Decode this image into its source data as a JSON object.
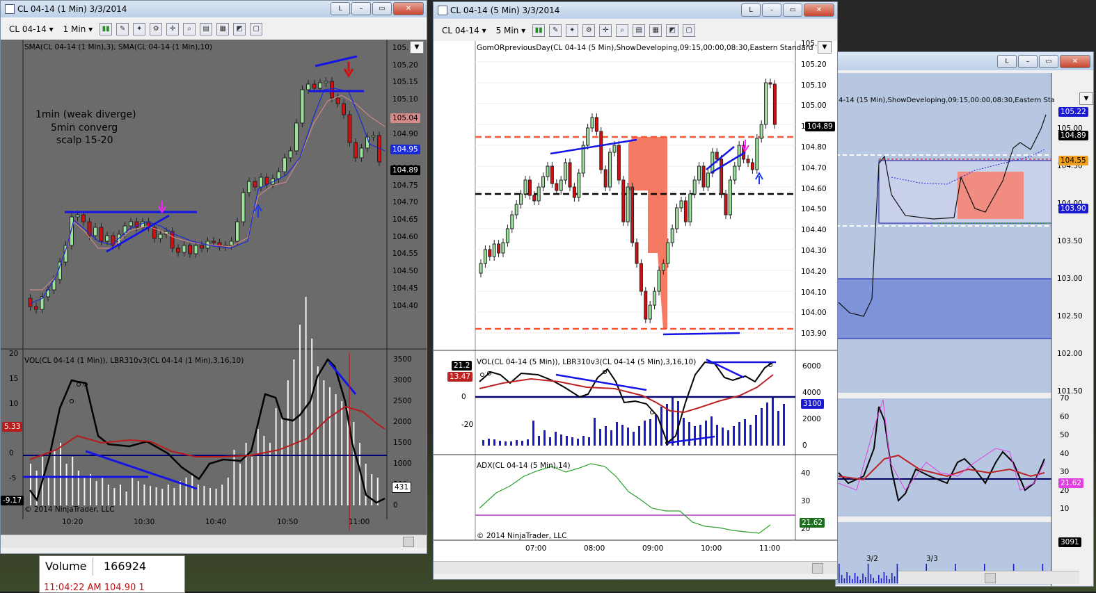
{
  "windows": {
    "left": {
      "title": "CL 04-14 (1 Min)  3/3/2014",
      "instrument": "CL 04-14",
      "interval": "1 Min",
      "btn_l": "L",
      "price_indicator": "SMA(CL 04-14 (1 Min),3), SMA(CL 04-14 (1 Min),10)",
      "note_lines": [
        "1min (weak diverge)",
        "5min converg",
        "scalp 15-20"
      ],
      "price_ticks": [
        "105.",
        "105.20",
        "105.15",
        "105.10",
        "105.00",
        "104.90",
        "104.85",
        "104.80",
        "104.75",
        "104.70",
        "104.65",
        "104.60",
        "104.55",
        "104.50",
        "104.45",
        "104.40"
      ],
      "price_tags": {
        "sma_red": "105.04",
        "sma_blue": "104.95",
        "last": "104.89"
      },
      "osc_indicator": "VOL(CL 04-14 (1 Min)), LBR310v3(CL 04-14 (1 Min),3,16,10)",
      "osc_left_ticks": [
        "20",
        "15",
        "10",
        "5",
        "0",
        "-5",
        "-10"
      ],
      "osc_tags": {
        "osc_red": "5.33",
        "osc_black": "-9.17",
        "vol": "431"
      },
      "vol_ticks": [
        "3500",
        "3000",
        "2500",
        "2000",
        "1500",
        "1000",
        "500",
        "0"
      ],
      "copyright": "© 2014 NinjaTrader, LLC",
      "time_ticks": [
        "10:20",
        "10:30",
        "10:40",
        "10:50",
        "11:00"
      ],
      "volume_label": "Volume",
      "volume_value": "166924",
      "tape_row": "11:04:22 AM   104.90     1"
    },
    "middle": {
      "title": "CL 04-14 (5 Min)  3/3/2014",
      "instrument": "CL 04-14",
      "interval": "5 Min",
      "btn_l": "L",
      "price_indicator": "GomORpreviousDay(CL 04-14 (5 Min),ShowDeveloping,09:15,00:00,08:30,Eastern Standard",
      "price_ticks": [
        "105.",
        "105.20",
        "105.10",
        "105.00",
        "104.90",
        "104.80",
        "104.70",
        "104.60",
        "104.50",
        "104.40",
        "104.30",
        "104.20",
        "104.10",
        "104.00",
        "103.90"
      ],
      "price_tags": {
        "last": "104.89"
      },
      "osc_indicator": "VOL(CL 04-14 (5 Min)), LBR310v3(CL 04-14 (5 Min),3,16,10)",
      "osc_left_ticks": [
        "0",
        "-20"
      ],
      "osc_tags": {
        "osc_black": "21.2",
        "osc_red": "13.47",
        "vol": "3100"
      },
      "vol_ticks": [
        "6000",
        "4000",
        "2000",
        "0"
      ],
      "adx_indicator": "ADX(CL 04-14 (5 Min),14)",
      "adx_ticks": [
        "40",
        "30",
        "20"
      ],
      "adx_tag": "21.62",
      "copyright": "© 2014 NinjaTrader, LLC",
      "time_ticks": [
        "07:00",
        "08:00",
        "09:00",
        "10:00",
        "11:00"
      ]
    },
    "right": {
      "btn_l": "L",
      "price_indicator": "4-14 (15 Min),ShowDeveloping,09:15,00:00,08:30,Eastern Sta",
      "price_ticks": [
        "105.00",
        "104.50",
        "104.00",
        "103.50",
        "103.00",
        "102.50",
        "102.00",
        "101.50"
      ],
      "price_tags": {
        "high": "105.22",
        "last": "104.89",
        "orange": "104.55",
        "low": "103.90"
      },
      "osc_ticks": [
        "70",
        "60",
        "50",
        "40",
        "30",
        "20",
        "10"
      ],
      "osc_tag": "21.62",
      "vol_tag": "3091",
      "time_ticks": [
        "3/2",
        "3/3"
      ]
    }
  },
  "colors": {
    "left_bg": "#6b6b6b",
    "chart_bg": "#ffffff",
    "right_bg": "#b8c8e0",
    "up_candle": "#9be39b",
    "down_candle": "#d01010",
    "trend_line": "#1414e6",
    "level_red": "#ff5530",
    "level_black": "#000000",
    "zone_red": "#f47a63",
    "vol_bar": "#1a1ad0",
    "magenta": "#ff20ff"
  }
}
